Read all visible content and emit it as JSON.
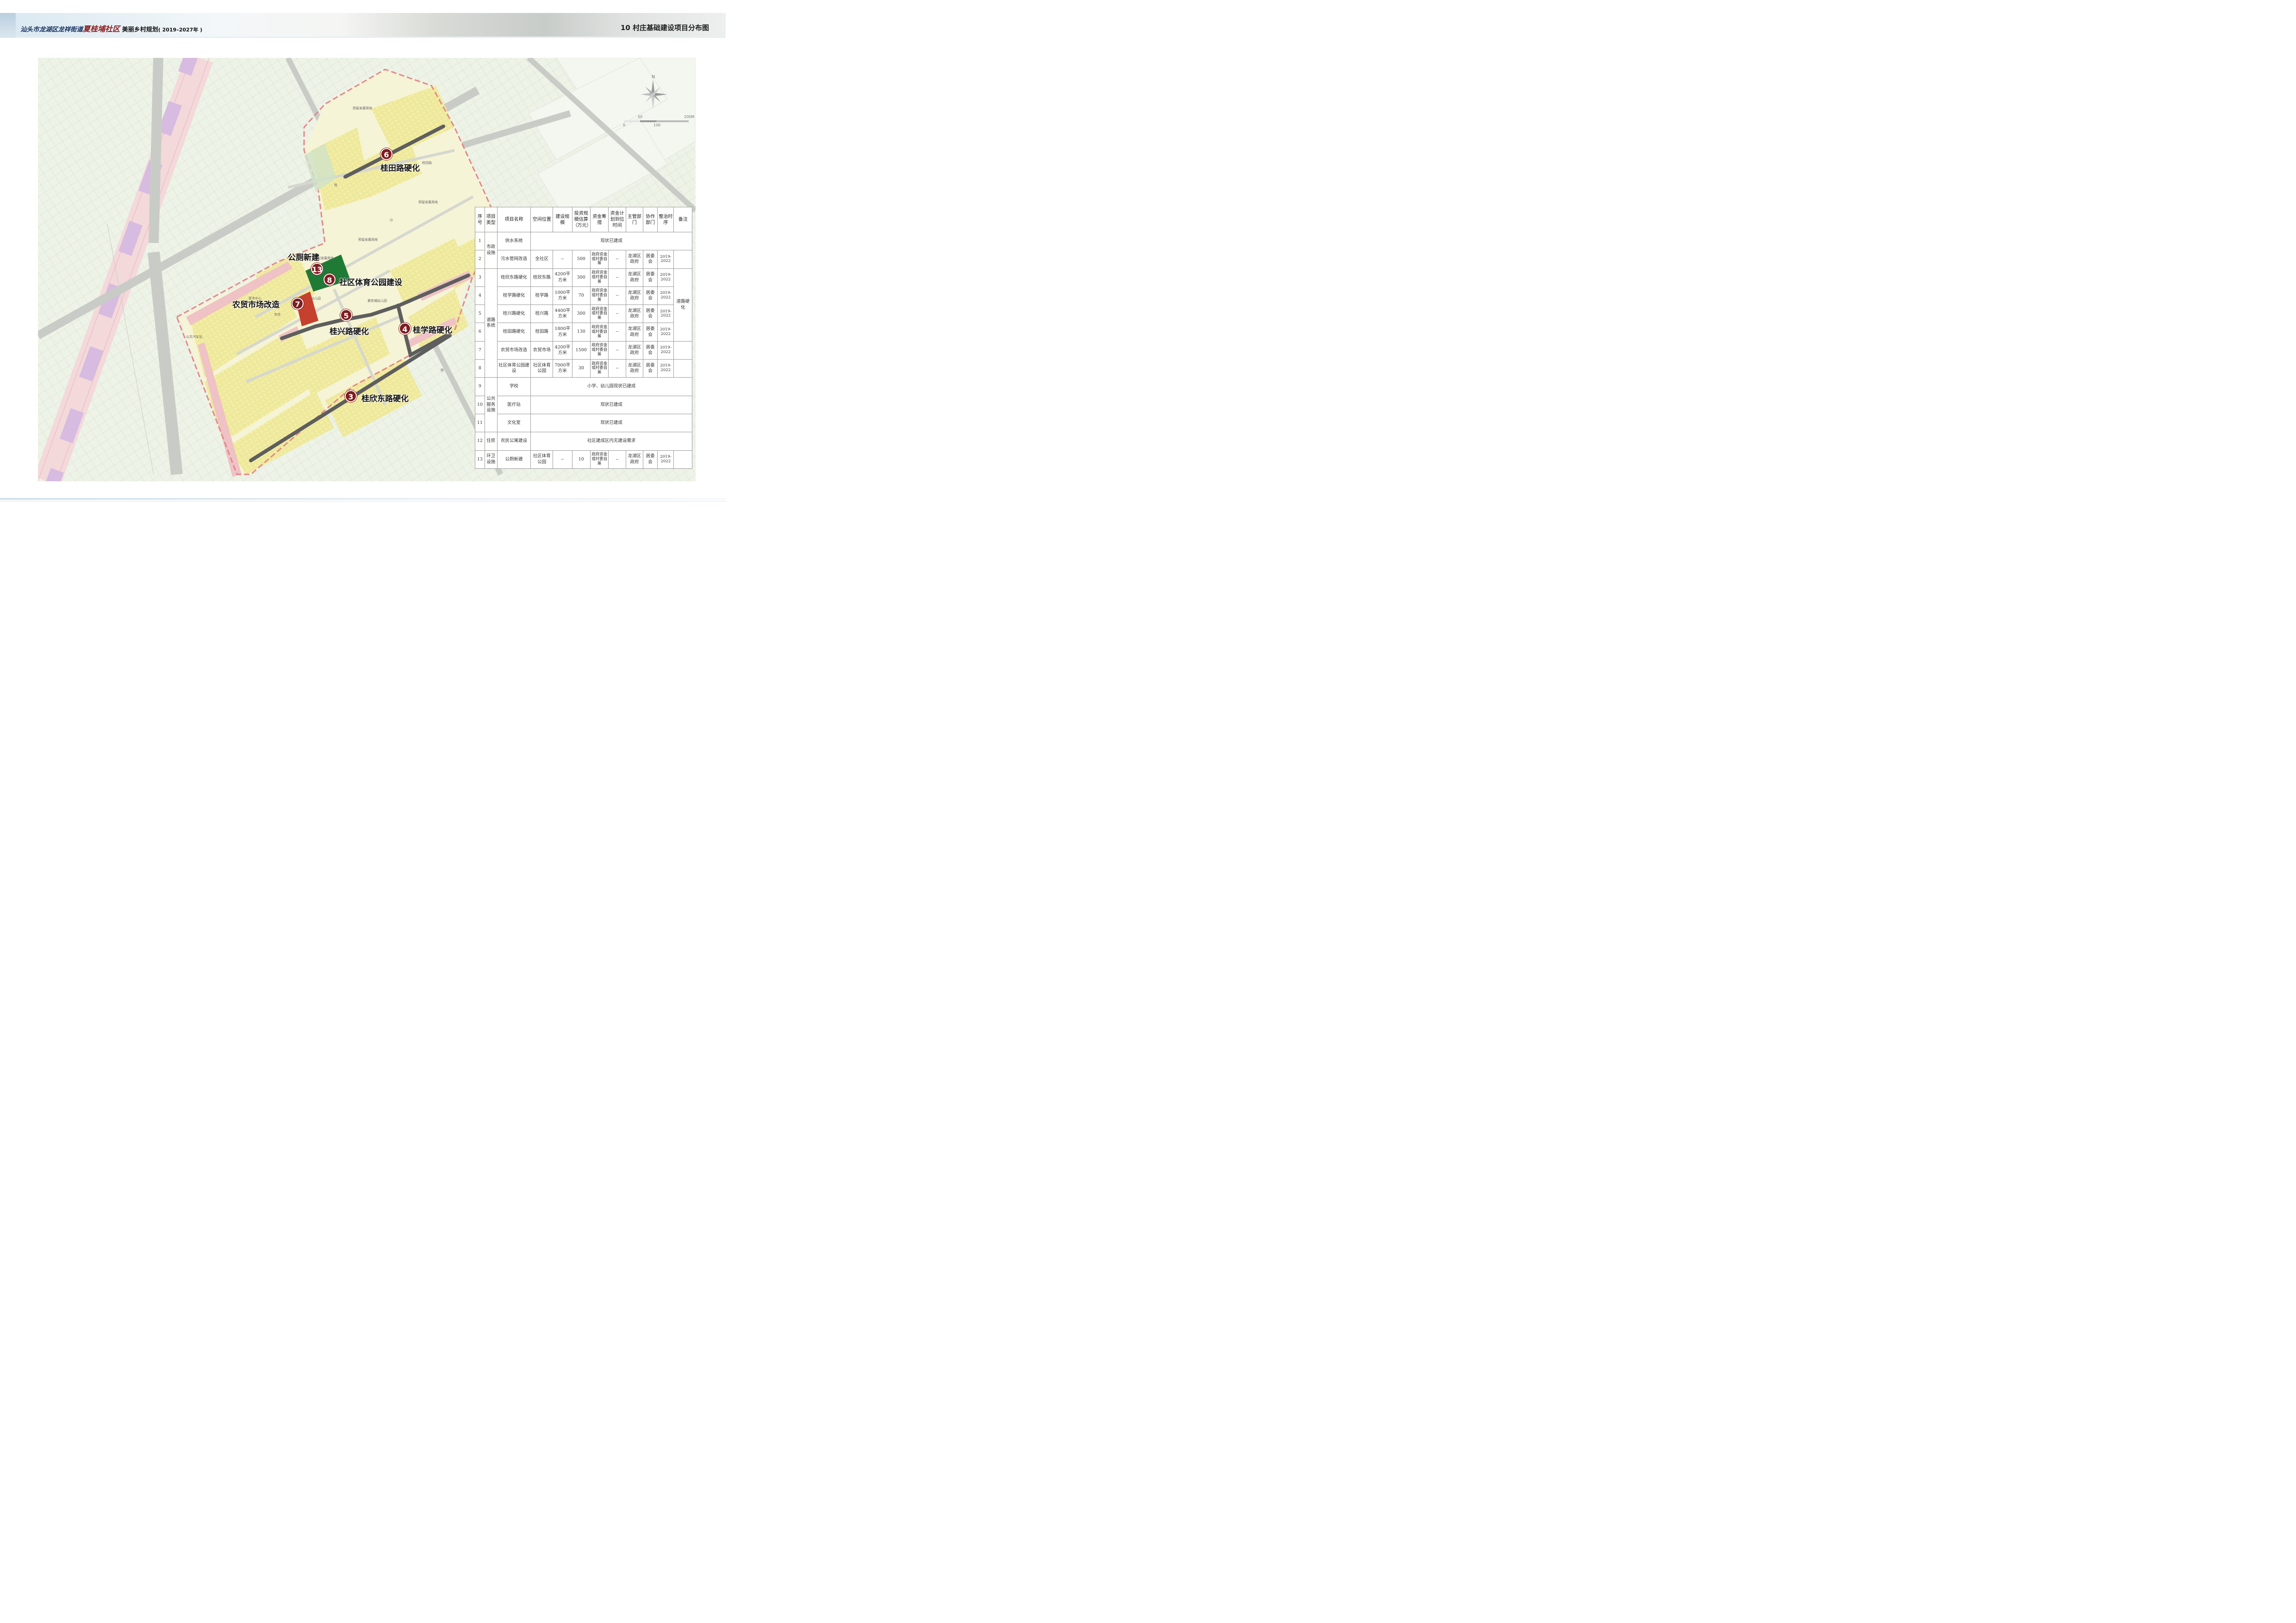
{
  "header": {
    "title_left_part1": "汕头市龙湖区龙祥街道",
    "title_left_part2": "夏桂埔社区",
    "title_left_part3": "美丽乡村规划",
    "title_left_year": "( 2019–2027年 )",
    "title_right": "10 村庄基础建设项目分布图"
  },
  "map": {
    "compass_north": "N",
    "scale": {
      "labels": [
        "0",
        "50",
        "100",
        "200M"
      ]
    },
    "area_labels": [
      "预留发展用地",
      "预留发展用地",
      "预留发展用地",
      "预留发展用地",
      "桂田路",
      "山",
      "桂",
      "桂",
      "幼儿园",
      "夏桂埔幼儿园",
      "市场",
      "农贸市场",
      "菜市中心",
      "公共汽车站"
    ],
    "projects": [
      {
        "number": "6",
        "label": "桂田路硬化"
      },
      {
        "number": "13",
        "label": "公厕新建"
      },
      {
        "number": "8",
        "label": "社区体育公园建设"
      },
      {
        "number": "7",
        "label": "农贸市场改造"
      },
      {
        "number": "5",
        "label": "桂兴路硬化"
      },
      {
        "number": "4",
        "label": "桂学路硬化"
      },
      {
        "number": "3",
        "label": "桂欣东路硬化"
      }
    ],
    "colors": {
      "road_highlight": "#5e5e5e",
      "marker": "#7d1d1f",
      "market_block": "#c5402d",
      "park_block": "#1f7a36",
      "residential": "#f3eda0",
      "boundary": "#e07b7b"
    }
  },
  "table": {
    "headers": [
      "序号",
      "项目类型",
      "项目名称",
      "空间位置",
      "建设规模",
      "投资规模估算（万元）",
      "资金筹措",
      "资金计划到位时间",
      "主管部门",
      "协作部门",
      "整治时序",
      "备注"
    ],
    "categories": {
      "municipal": "市政设施",
      "road": "道路系统",
      "public_service": "公共服务设施",
      "housing": "住房",
      "sanitation": "环卫设施"
    },
    "remark_roads": "道路硬化",
    "rows": [
      {
        "no": "1",
        "name": "供水系统",
        "span_text": "现状已建成"
      },
      {
        "no": "2",
        "name": "污水管网改造",
        "location": "全社区",
        "scale": "--",
        "invest": "500",
        "funding": "政府资金或村委自筹",
        "fund_time": "--",
        "lead": "龙湖区政府",
        "coop": "居委会",
        "period": "2019-2022"
      },
      {
        "no": "3",
        "name": "桂欣东路硬化",
        "location": "桂欣东路",
        "scale": "4200平方米",
        "invest": "300",
        "funding": "政府资金或村委自筹",
        "fund_time": "--",
        "lead": "龙湖区政府",
        "coop": "居委会",
        "period": "2019-2022"
      },
      {
        "no": "4",
        "name": "桂学路硬化",
        "location": "桂学路",
        "scale": "1000平方米",
        "invest": "70",
        "funding": "政府资金或村委自筹",
        "fund_time": "--",
        "lead": "龙湖区政府",
        "coop": "居委会",
        "period": "2019-2022"
      },
      {
        "no": "5",
        "name": "桂兴路硬化",
        "location": "桂兴路",
        "scale": "4400平方米",
        "invest": "300",
        "funding": "政府资金或村委自筹",
        "fund_time": "--",
        "lead": "龙湖区政府",
        "coop": "居委会",
        "period": "2019-2022"
      },
      {
        "no": "6",
        "name": "桂田路硬化",
        "location": "桂田路",
        "scale": "1800平方米",
        "invest": "130",
        "funding": "政府资金或村委自筹",
        "fund_time": "--",
        "lead": "龙湖区政府",
        "coop": "居委会",
        "period": "2019-2022"
      },
      {
        "no": "7",
        "name": "农贸市场改造",
        "location": "农贸市场",
        "scale": "4200平方米",
        "invest": "1500",
        "funding": "政府资金或村委自筹",
        "fund_time": "--",
        "lead": "龙湖区政府",
        "coop": "居委会",
        "period": "2019-2022"
      },
      {
        "no": "8",
        "name": "社区体育公园建设",
        "location": "社区体育公园",
        "scale": "7000平方米",
        "invest": "30",
        "funding": "政府资金或村委自筹",
        "fund_time": "--",
        "lead": "龙湖区政府",
        "coop": "居委会",
        "period": "2019-2022"
      },
      {
        "no": "9",
        "name": "学校",
        "span_text": "小学、幼儿园现状已建成"
      },
      {
        "no": "10",
        "name": "医疗站",
        "span_text": "现状已建成"
      },
      {
        "no": "11",
        "name": "文化室",
        "span_text": "现状已建成"
      },
      {
        "no": "12",
        "name": "农民公寓建设",
        "span_text": "社区建成区内无建设需求"
      },
      {
        "no": "13",
        "name": "公厕新建",
        "location": "社区体育公园",
        "scale": "--",
        "invest": "10",
        "funding": "政府资金或村委自筹",
        "fund_time": "--",
        "lead": "龙湖区政府",
        "coop": "居委会",
        "period": "2019-2022"
      }
    ]
  }
}
